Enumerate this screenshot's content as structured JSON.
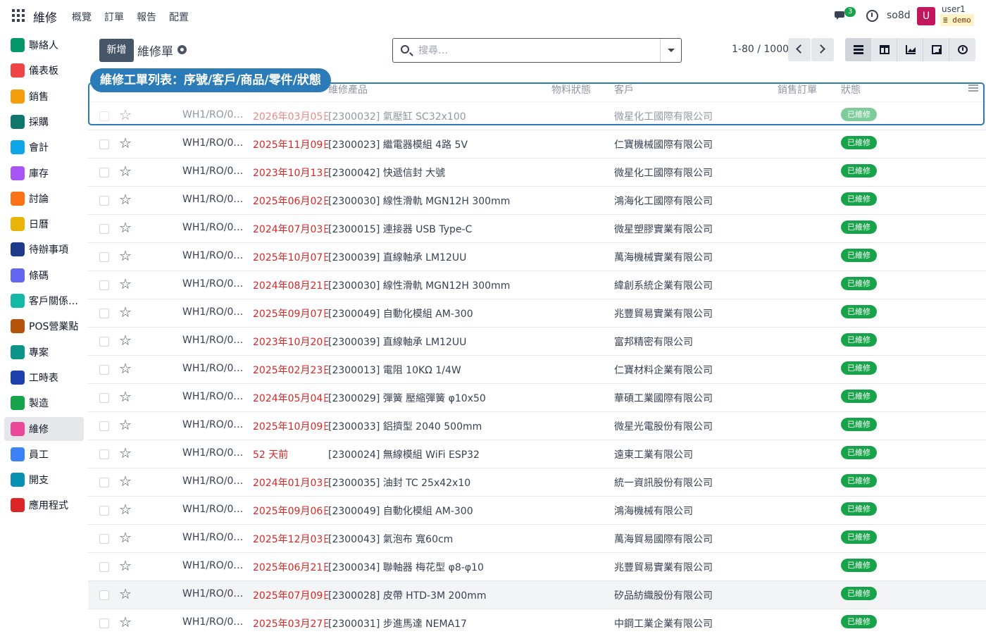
{
  "topnav": {
    "brand": "維修",
    "menu": [
      "概覽",
      "訂單",
      "報告",
      "配置"
    ],
    "chat_badge": "3",
    "db_name": "so8d",
    "avatar_letter": "U",
    "user_name": "user1",
    "db_badge": "≣ demo"
  },
  "sidebar": [
    {
      "label": "聯絡人",
      "icon": "contacts-icon",
      "color": "#059669"
    },
    {
      "label": "儀表板",
      "icon": "dashboard-icon",
      "color": "#ef4444"
    },
    {
      "label": "銷售",
      "icon": "sales-icon",
      "color": "#f59e0b"
    },
    {
      "label": "採購",
      "icon": "purchase-icon",
      "color": "#0f766e"
    },
    {
      "label": "會計",
      "icon": "accounting-icon",
      "color": "#0ea5e9"
    },
    {
      "label": "庫存",
      "icon": "inventory-icon",
      "color": "#a855f7"
    },
    {
      "label": "討論",
      "icon": "discuss-icon",
      "color": "#f97316"
    },
    {
      "label": "日曆",
      "icon": "calendar-icon",
      "color": "#eab308"
    },
    {
      "label": "待辦事項",
      "icon": "todo-icon",
      "color": "#1e3a8a"
    },
    {
      "label": "條碼",
      "icon": "barcode-icon",
      "color": "#6366f1"
    },
    {
      "label": "客戶關係…",
      "icon": "crm-icon",
      "color": "#14b8a6"
    },
    {
      "label": "POS營業點",
      "icon": "pos-icon",
      "color": "#b45309"
    },
    {
      "label": "專案",
      "icon": "project-icon",
      "color": "#0d9488"
    },
    {
      "label": "工時表",
      "icon": "timesheet-icon",
      "color": "#1e40af"
    },
    {
      "label": "製造",
      "icon": "manufacturing-icon",
      "color": "#16a34a"
    },
    {
      "label": "維修",
      "icon": "repair-icon",
      "color": "#ec4899"
    },
    {
      "label": "員工",
      "icon": "employees-icon",
      "color": "#3b82f6"
    },
    {
      "label": "開支",
      "icon": "expenses-icon",
      "color": "#0891b2"
    },
    {
      "label": "應用程式",
      "icon": "apps-store-icon",
      "color": "#dc2626"
    }
  ],
  "control": {
    "new_label": "新增",
    "breadcrumb": "維修單",
    "search_placeholder": "搜尋…",
    "pager": "1-80 / 1000"
  },
  "annotation": "維修工單列表：序號/客戶/商品/零件/狀態",
  "columns": {
    "product": "維修產品",
    "material": "物料狀態",
    "customer": "客戶",
    "sale_order": "銷售訂單",
    "status": "狀態"
  },
  "rows": [
    {
      "ref": "WH1/RO/00…",
      "date": "2026年03月05日",
      "product": "[2300032] 氣壓缸 SC32x100",
      "customer": "微星化工國際有限公司",
      "status": "已維修"
    },
    {
      "ref": "WH1/RO/00…",
      "date": "2025年11月09日",
      "product": "[2300023] 繼電器模組 4路 5V",
      "customer": "仁寶機械國際有限公司",
      "status": "已維修"
    },
    {
      "ref": "WH1/RO/00…",
      "date": "2023年10月13日",
      "product": "[2300042] 快遞信封 大號",
      "customer": "微星化工國際有限公司",
      "status": "已維修"
    },
    {
      "ref": "WH1/RO/00…",
      "date": "2025年06月02日",
      "product": "[2300030] 線性滑軌 MGN12H 300mm",
      "customer": "鴻海化工國際有限公司",
      "status": "已維修"
    },
    {
      "ref": "WH1/RO/00…",
      "date": "2024年07月03日",
      "product": "[2300015] 連接器 USB Type-C",
      "customer": "微星塑膠實業有限公司",
      "status": "已維修"
    },
    {
      "ref": "WH1/RO/00…",
      "date": "2025年10月07日",
      "product": "[2300039] 直線軸承 LM12UU",
      "customer": "萬海機械實業有限公司",
      "status": "已維修"
    },
    {
      "ref": "WH1/RO/00…",
      "date": "2024年08月21日",
      "product": "[2300030] 線性滑軌 MGN12H 300mm",
      "customer": "緯創系統企業有限公司",
      "status": "已維修"
    },
    {
      "ref": "WH1/RO/00…",
      "date": "2025年09月07日",
      "product": "[2300049] 自動化模組 AM-300",
      "customer": "兆豐貿易實業有限公司",
      "status": "已維修"
    },
    {
      "ref": "WH1/RO/00…",
      "date": "2023年10月20日",
      "product": "[2300039] 直線軸承 LM12UU",
      "customer": "富邦精密有限公司",
      "status": "已維修"
    },
    {
      "ref": "WH1/RO/00…",
      "date": "2025年02月23日",
      "product": "[2300013] 電阻 10KΩ 1/4W",
      "customer": "仁寶材料企業有限公司",
      "status": "已維修"
    },
    {
      "ref": "WH1/RO/00…",
      "date": "2024年05月04日",
      "product": "[2300029] 彈簧 壓縮彈簧 φ10x50",
      "customer": "華碩工業國際有限公司",
      "status": "已維修"
    },
    {
      "ref": "WH1/RO/00…",
      "date": "2025年10月09日",
      "product": "[2300033] 鋁擠型 2040 500mm",
      "customer": "微星光電股份有限公司",
      "status": "已維修"
    },
    {
      "ref": "WH1/RO/00…",
      "date": "52 天前",
      "product": "[2300024] 無線模組 WiFi ESP32",
      "customer": "遠東工業有限公司",
      "status": "已維修"
    },
    {
      "ref": "WH1/RO/00…",
      "date": "2024年01月03日",
      "product": "[2300035] 油封 TC 25x42x10",
      "customer": "統一資訊股份有限公司",
      "status": "已維修"
    },
    {
      "ref": "WH1/RO/00…",
      "date": "2025年09月06日",
      "product": "[2300049] 自動化模組 AM-300",
      "customer": "鴻海機械有限公司",
      "status": "已維修"
    },
    {
      "ref": "WH1/RO/00…",
      "date": "2025年12月03日",
      "product": "[2300043] 氣泡布 寬60cm",
      "customer": "萬海貿易國際有限公司",
      "status": "已維修"
    },
    {
      "ref": "WH1/RO/00…",
      "date": "2025年06月21日",
      "product": "[2300034] 聯軸器 梅花型 φ8-φ10",
      "customer": "兆豐貿易實業有限公司",
      "status": "已維修"
    },
    {
      "ref": "WH1/RO/00…",
      "date": "2025年07月09日",
      "product": "[2300028] 皮帶 HTD-3M 200mm",
      "customer": "矽品紡織股份有限公司",
      "status": "已維修"
    },
    {
      "ref": "WH1/RO/00…",
      "date": "2025年03月27日",
      "product": "[2300031] 步進馬達 NEMA17",
      "customer": "中鋼工業企業有限公司",
      "status": "已維修"
    }
  ]
}
